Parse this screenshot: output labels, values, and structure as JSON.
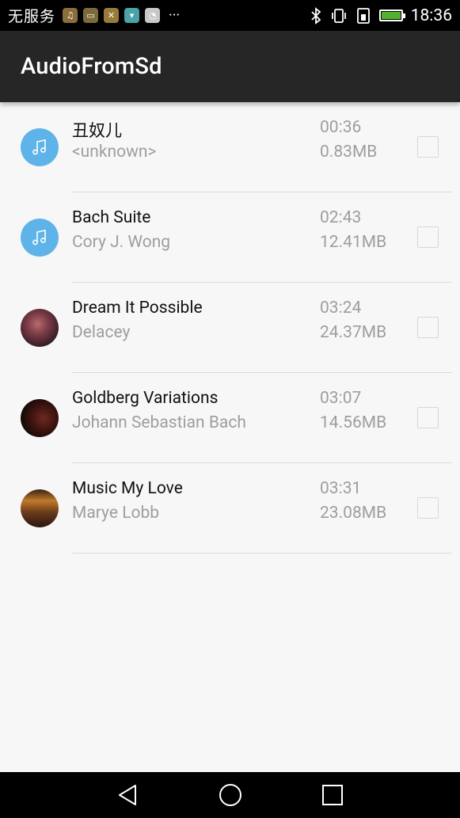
{
  "status_bar": {
    "carrier": "无服务",
    "notification_icons": [
      "music-app-icon",
      "media-app-icon",
      "tools-app-icon",
      "android-app-icon",
      "shopping-app-icon"
    ],
    "more": "···",
    "time": "18:36",
    "icons": [
      "bluetooth-icon",
      "vibrate-icon",
      "sim-icon",
      "battery-icon"
    ]
  },
  "app_bar": {
    "title": "AudioFromSd"
  },
  "songs": [
    {
      "title": "丑奴儿",
      "artist": "<unknown>",
      "duration": "00:36",
      "size": "0.83MB",
      "thumbnail": "music-note-icon",
      "checked": false
    },
    {
      "title": "Bach Suite",
      "artist": "Cory J. Wong",
      "duration": "02:43",
      "size": "12.41MB",
      "thumbnail": "music-note-icon",
      "checked": false
    },
    {
      "title": "Dream It Possible",
      "artist": "Delacey",
      "duration": "03:24",
      "size": "24.37MB",
      "thumbnail": "album-art",
      "checked": false
    },
    {
      "title": "Goldberg Variations",
      "artist": "Johann Sebastian Bach",
      "duration": "03:07",
      "size": "14.56MB",
      "thumbnail": "album-art",
      "checked": false
    },
    {
      "title": "Music My Love",
      "artist": "Marye Lobb",
      "duration": "03:31",
      "size": "23.08MB",
      "thumbnail": "album-art",
      "checked": false
    }
  ],
  "nav_bar": {
    "buttons": [
      "back-icon",
      "home-icon",
      "recents-icon"
    ]
  }
}
